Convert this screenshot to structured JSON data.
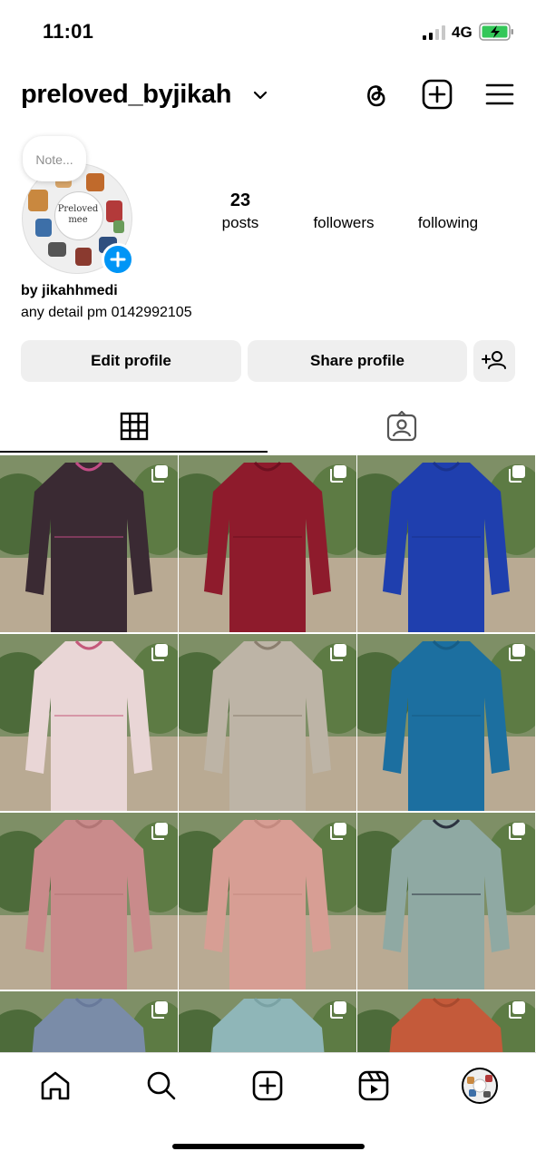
{
  "status_bar": {
    "time": "11:01",
    "network": "4G"
  },
  "header": {
    "username": "preloved_byjikah"
  },
  "profile": {
    "note_placeholder": "Note...",
    "avatar_text": "Preloved mee",
    "stats": [
      {
        "value": "23",
        "label": "posts"
      },
      {
        "value": "",
        "label": "followers"
      },
      {
        "value": "",
        "label": "following"
      }
    ],
    "bio_name": "by jikahhmedi",
    "bio_text": "any detail pm 0142992105"
  },
  "buttons": {
    "edit": "Edit profile",
    "share": "Share profile"
  },
  "tabs": [
    {
      "icon": "grid-icon",
      "selected": true
    },
    {
      "icon": "tagged-icon",
      "selected": false
    }
  ],
  "posts": [
    {
      "garment": "black floral print kurung",
      "color": "#3a2a33",
      "accent": "#c24d86"
    },
    {
      "garment": "red kurung",
      "color": "#8e1b2c",
      "accent": "#6e1020"
    },
    {
      "garment": "blue kurung",
      "color": "#1f3fae",
      "accent": "#1a338e"
    },
    {
      "garment": "pink floral kurung",
      "color": "#e9d6d6",
      "accent": "#c4587a"
    },
    {
      "garment": "grey patterned kurung",
      "color": "#bdb4a6",
      "accent": "#8a7e6e"
    },
    {
      "garment": "teal kurung",
      "color": "#1c6fa0",
      "accent": "#175d86"
    },
    {
      "garment": "dusty pink kurung",
      "color": "#c98b8b",
      "accent": "#b27575"
    },
    {
      "garment": "salmon pink kurung",
      "color": "#d79e94",
      "accent": "#c48a80"
    },
    {
      "garment": "sage green kurung",
      "color": "#8fa9a3",
      "accent": "#2c3340"
    },
    {
      "garment": "slate blue kurung",
      "color": "#7a8ca8",
      "accent": "#68799a"
    },
    {
      "garment": "pale teal kurung",
      "color": "#8fb6b8",
      "accent": "#7aa2a4"
    },
    {
      "garment": "rust orange kurung",
      "color": "#c45a3a",
      "accent": "#a84a2e"
    }
  ],
  "colors": {
    "accent": "#0095f6",
    "button_bg": "#efefef",
    "muted_text": "#8e8e8e"
  }
}
